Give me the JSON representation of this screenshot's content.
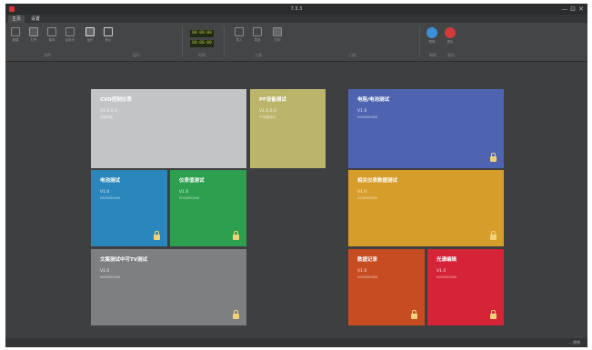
{
  "window": {
    "title": "7.3.3",
    "controls": [
      "—",
      "⊡",
      "✕"
    ]
  },
  "menu": {
    "tabs": [
      {
        "label": "主页",
        "active": true
      },
      {
        "label": "设置",
        "active": false
      }
    ]
  },
  "ribbon": {
    "buttons": [
      {
        "label": "新建",
        "icon": "new-file-icon"
      },
      {
        "label": "打开",
        "icon": "open-folder-icon"
      },
      {
        "label": "保存",
        "icon": "save-icon"
      },
      {
        "label": "另存为",
        "icon": "save-as-icon"
      },
      {
        "label": "运行",
        "icon": "play-icon"
      },
      {
        "label": "停止",
        "icon": "stop-icon"
      }
    ],
    "time_start": "00:00:00",
    "time_end": "00:00:00",
    "tools": [
      {
        "label": "导入",
        "icon": "import-icon"
      },
      {
        "label": "导出",
        "icon": "export-icon"
      },
      {
        "label": "打印",
        "icon": "print-icon"
      }
    ],
    "actions": [
      {
        "label": "帮助",
        "icon": "help-icon",
        "color": "#3c8fd8"
      },
      {
        "label": "退出",
        "icon": "exit-icon",
        "color": "#d23b3b"
      }
    ],
    "group_labels": [
      "文件",
      "运行",
      "时间",
      "工具",
      "日志",
      "帮助",
      "退出"
    ]
  },
  "tiles": [
    {
      "name": "CVD控制仪表",
      "version": "V1.0.0.0",
      "sub": "控制界面",
      "color": "#c3c4c6",
      "locked": false
    },
    {
      "name": "PF设备测试",
      "version": "V1.0.0.0",
      "sub": "PF设备测试",
      "color": "#bab56a",
      "locked": false
    },
    {
      "name": "电阻/电池测试",
      "version": "V1.0",
      "sub": "0000000000",
      "color": "#4e64b1",
      "locked": true
    },
    {
      "name": "电池测试",
      "version": "V1.0",
      "sub": "0000000000",
      "color": "#2a86bb",
      "locked": true
    },
    {
      "name": "仪表值测试",
      "version": "V1.0",
      "sub": "0000000000",
      "color": "#2e9f4f",
      "locked": true
    },
    {
      "name": "相关仪表数据测试",
      "version": "V1.0",
      "sub": "0000000000",
      "color": "#d79d2b",
      "locked": true
    },
    {
      "name": "文案测试中可TV测试",
      "version": "V1.0",
      "sub": "0000000000",
      "color": "#7e7f81",
      "locked": true
    },
    {
      "name": "数据记录",
      "version": "V1.0",
      "sub": "0000000000",
      "color": "#c84c22",
      "locked": true
    },
    {
      "name": "光谱编辑",
      "version": "V1.0",
      "sub": "0000000000",
      "color": "#d52337",
      "locked": true
    }
  ],
  "status": {
    "text": "...  就绪"
  }
}
